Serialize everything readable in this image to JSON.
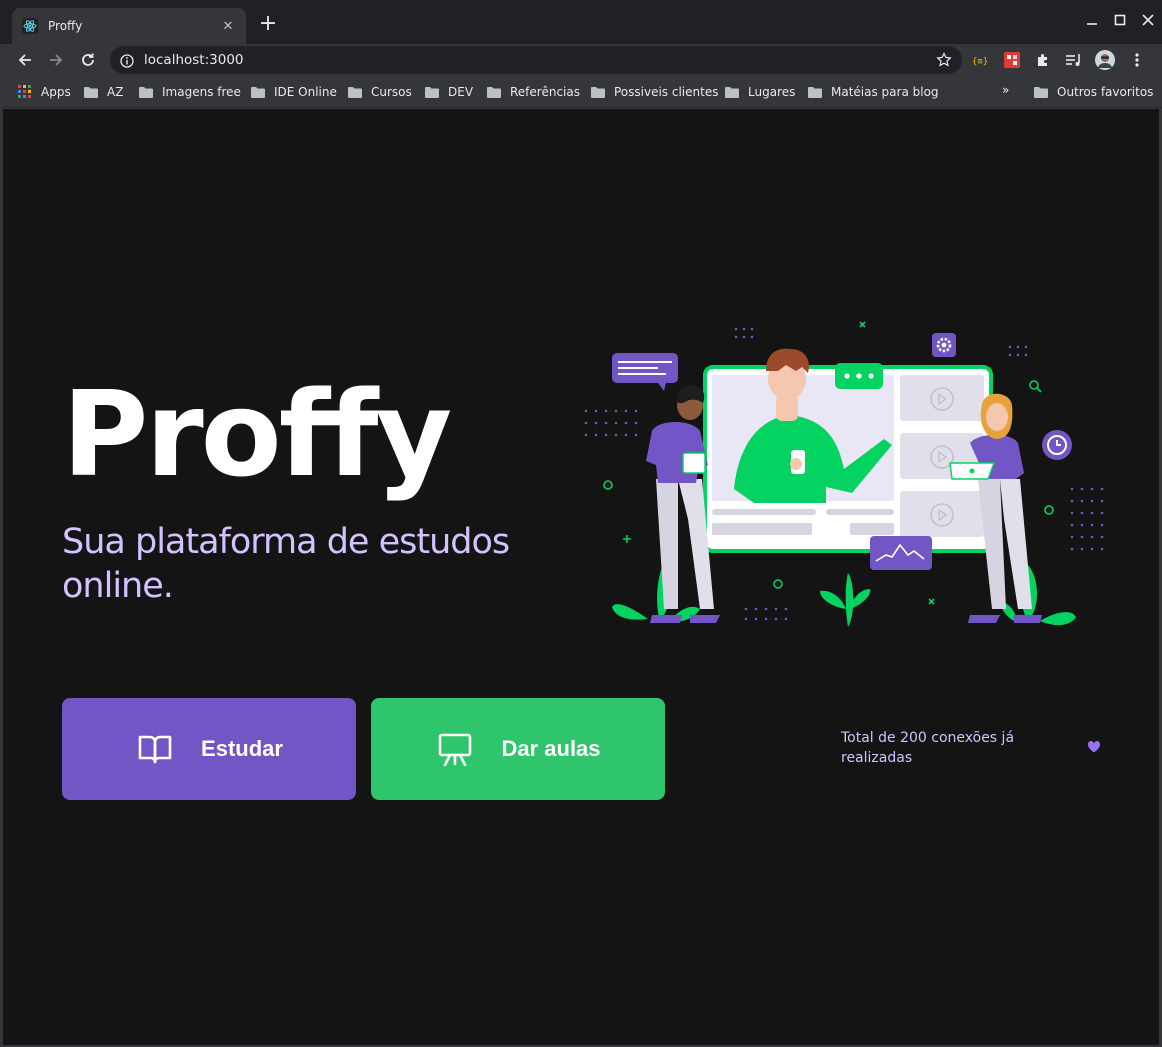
{
  "browser": {
    "tab_title": "Proffy",
    "url": "localhost:3000",
    "bookmarks": [
      "Apps",
      "AZ",
      "Imagens free",
      "IDE Online",
      "Cursos",
      "DEV",
      "Referências",
      "Possiveis clientes",
      "Lugares",
      "Matéias para blog"
    ],
    "bookmarks_overflow": "»",
    "other_bookmarks": "Outros favoritos"
  },
  "page": {
    "logo_text": "Proffy",
    "subtitle": "Sua plataforma de estudos online.",
    "study_button": "Estudar",
    "teach_button": "Dar aulas",
    "connections_text": "Total de 200 conexões já realizadas"
  },
  "colors": {
    "background": "#141414",
    "primary_purple": "#7356c5",
    "secondary_green": "#2ec56c",
    "text_lavender": "#d4c2ff",
    "heart": "#9871f5"
  },
  "icons": {
    "study": "open-book-icon",
    "teach": "presentation-board-icon",
    "heart": "purple-heart-icon"
  }
}
